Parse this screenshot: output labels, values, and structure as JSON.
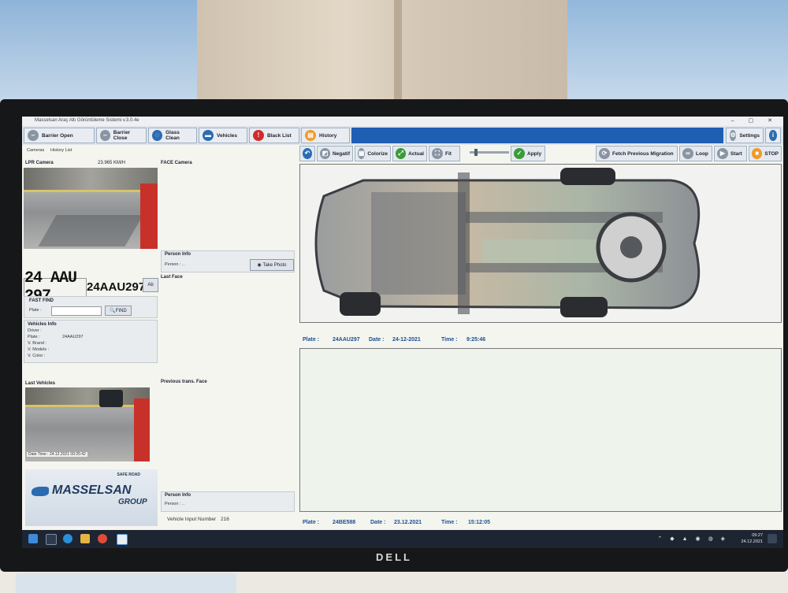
{
  "app": {
    "window_title": "Masselsan Araç Altı Görüntüleme Sistemi v.3.0.4e",
    "toolbar": {
      "barrier_open": "Barrier Open",
      "barrier_close": "Barrier Close",
      "glass_clean": "Glass Clean",
      "vehicles": "Vehicles",
      "black_list": "Black List",
      "history": "History",
      "settings": "Settings"
    },
    "subtabs": [
      "Cameras",
      "History List"
    ],
    "lpr": {
      "title": "LPR Camera",
      "speed": "23.965 KM/H",
      "plate_image_text": "24 AAU 297",
      "plate_read": "24AAU297",
      "plate_badge": "Ab"
    },
    "fast_find": {
      "title": "FAST FIND",
      "plate_label": "Plate :",
      "find_label": "FIND"
    },
    "vehicle_info": {
      "title": "Vehicles Info",
      "rows": [
        {
          "label": "Driver :",
          "value": ""
        },
        {
          "label": "Plate :",
          "value": "24AAU297"
        },
        {
          "label": "V. Brand :",
          "value": ""
        },
        {
          "label": "V. Models :",
          "value": ""
        },
        {
          "label": "V. Color :",
          "value": ""
        }
      ]
    },
    "last_vehicles": {
      "title": "Last Vehicles",
      "date_time": "Date Time : 24.12.2021 09:25:42"
    },
    "brand": {
      "tagline": "SAFE ROAD",
      "name": "MASSELSAN",
      "group": "GROUP"
    },
    "face": {
      "title": "FACE Camera",
      "person_info": "Person Info",
      "person_label": "Person : ..",
      "take_photo": "Take Photo",
      "last_face": "Last Face",
      "previous_face": "Previous trans. Face",
      "person_info_2": "Person Info",
      "person_label_2": "Person : ..",
      "vehicle_input_label": "Vehicle Input Number",
      "vehicle_input_number": "216"
    },
    "controls": {
      "negatif": "Negatif",
      "colorize": "Colorize",
      "actual": "Actual",
      "fit": "Fit",
      "apply": "Apply",
      "fetch_previous": "Fetch Previous Migration",
      "loop": "Loop",
      "start": "Start",
      "stop": "STOP"
    },
    "current_scan": {
      "plate_label": "Plate :",
      "plate": "24AAU297",
      "date_label": "Date :",
      "date": "24-12-2021",
      "time_label": "Time :",
      "time": "9:25:46"
    },
    "previous_scan": {
      "plate_label": "Plate :",
      "plate": "24BE588",
      "date_label": "Date :",
      "date": "23.12.2021",
      "time_label": "Time :",
      "time": "15:12:05"
    },
    "taskbar": {
      "time": "09:27",
      "date": "24.12.2021"
    }
  },
  "monitor_brand": "DELL"
}
